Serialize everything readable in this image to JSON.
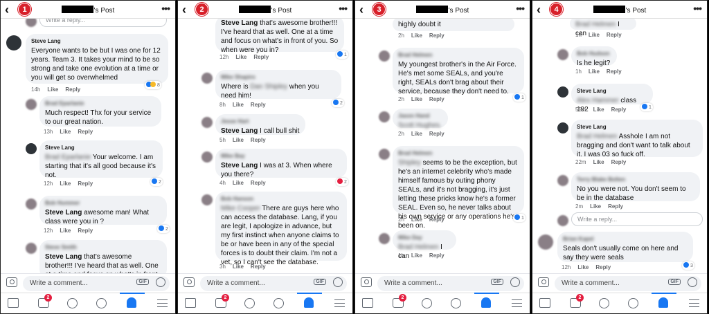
{
  "header": {
    "title_suffix": "'s Post",
    "back": "‹",
    "more": "•••"
  },
  "panels": [
    {
      "number": "1"
    },
    {
      "number": "2"
    },
    {
      "number": "3"
    },
    {
      "number": "4"
    }
  ],
  "composer": {
    "placeholder": "Write a comment...",
    "gif": "GIF"
  },
  "nav": {
    "watch_badge": "2"
  },
  "labels": {
    "like": "Like",
    "reply": "Reply",
    "write_reply": "Write a reply..."
  },
  "p1": {
    "c1": {
      "name": "Steve Lang",
      "text": "Everyone wants to be but I was one for 12 years. Team 3. It takes your mind to be so strong and take one evolution at a time or you will get so overwhelmed",
      "time": "14h",
      "reactions": "8"
    },
    "c2": {
      "name": "Brad Eparlanie",
      "text": "Much respect! Thx for your service to our great nation.",
      "time": "13h"
    },
    "c3": {
      "name": "Steve Lang",
      "tag": "Brad Eparlanie",
      "text": " Your welcome. I am starting that it's all good because it's not.",
      "time": "12h",
      "reactions": "2"
    },
    "c4": {
      "name": "Bob Hummer",
      "tag": "Steve Lang",
      "text": "  awesome man! What class were you in ?",
      "time": "12h",
      "reactions": "2"
    },
    "c5": {
      "name": "Steve Smith",
      "tag": "Steve Lang",
      "text": " that's awesome brother!!! I've heard that as well. One at a time and focus on what's in front of you. So"
    }
  },
  "p2": {
    "c1": {
      "tag": "Steve Lang",
      "text": " that's awesome brother!!! I've heard that as well. One at a time and focus on what's in front of you. So when were you in?",
      "time": "12h",
      "reactions": "1"
    },
    "c2": {
      "name": "Mike Shapiro",
      "pre": "Where is ",
      "tagblur": "Dan Shipley",
      "text": " when you need him!",
      "time": "8h",
      "reactions": "2"
    },
    "c3": {
      "name": "Jesse Hart",
      "tag": "Steve Lang",
      "text": " I call bull shit",
      "time": "5h"
    },
    "c4": {
      "name": "Mike Bay",
      "tag": "Steve Lang",
      "text": " I was at 3. When where you there?",
      "time": "4h",
      "reactions": "2"
    },
    "c5": {
      "name": "Bob Hanson",
      "tagblur": "Mike Cooper",
      "text": " There are guys here who can access the database. Lang, if you are legit, I apologize in advance, but my first instinct when anyone claims to be or have been in any of the special forces is to doubt their claim. I'm not a vet, so I can't see the database.",
      "time": "3h"
    }
  },
  "p3": {
    "c0": {
      "text": "highly doubt it",
      "time": "2h"
    },
    "c1": {
      "name": "Brad Helmen",
      "text": "My youngest brother's in the Air Force. He's met some SEALs, and you're right, SEALs don't brag about their service, because they don't need to.",
      "time": "2h",
      "reactions": "1"
    },
    "c2": {
      "name": "Jason Hand",
      "tagblur": "Scott Hughes.",
      "time": "2h"
    },
    "c3": {
      "name": "Brad Helmen",
      "tagblur": "Shipley",
      "text": " seems to be the exception, but he's an internet celebrity who's made himself famous by outing phony SEALs, and it's not bragging, it's just letting these pricks know he's a former SEAL. Even so, he never talks about his own service or any operations he's been on.",
      "time": "2h",
      "reactions": "1"
    },
    "c4": {
      "name": "Mike Day",
      "tagblur": "Brad Helmen",
      "text": " I can",
      "time": "1h"
    }
  },
  "p4": {
    "c0": {
      "tagblur": "Brad Helmen",
      "text": " I can",
      "time": "1h"
    },
    "c1": {
      "name": "Bob Hudson",
      "text": "Is he legit?",
      "time": "1h"
    },
    "c2": {
      "name": "Steve Lang",
      "tagblur": "Alex Hammer",
      "text": " class 192",
      "time": "55m",
      "reactions": "1"
    },
    "c3": {
      "name": "Steve Lang",
      "tagblur": "Brad Helmen",
      "text": " Asshole I am not bragging and don't want to talk about it. I was 03 so fuck off.",
      "time": "22m"
    },
    "c4": {
      "name": "Terry Blake Bolten",
      "text": "No you were not. You don't seem to be in the database",
      "time": "2m"
    },
    "c5": {
      "name": "Brian Kapel",
      "text": "Seals don't usually come on here and say they were seals",
      "time": "12h",
      "reactions": "3"
    }
  }
}
